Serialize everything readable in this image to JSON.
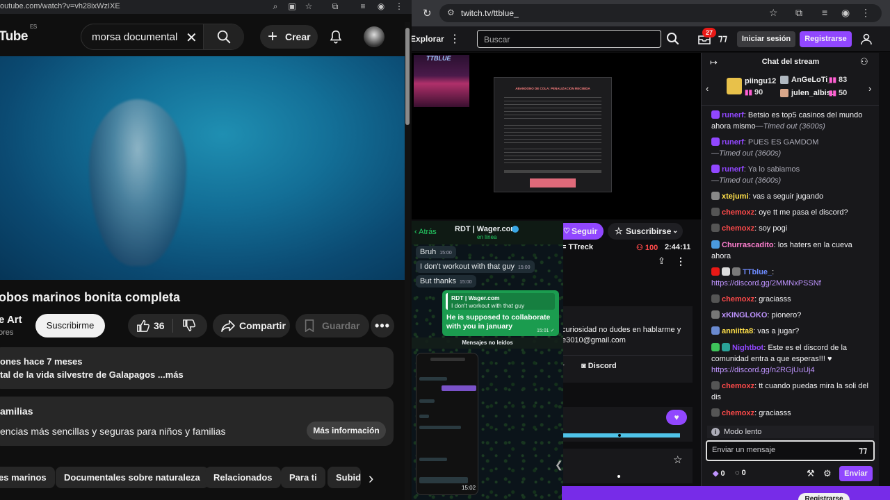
{
  "youtube": {
    "url": "outube.com/watch?v=vh28ixWzIXE",
    "logo": "Tube",
    "logo_region": "ES",
    "search_value": "morsa documental",
    "create_label": "Crear",
    "title": "obos marinos bonita completa",
    "channel": "e Art",
    "subs": "ores",
    "subscribe_label": "Suscribirme",
    "likes": "36",
    "share_label": "Compartir",
    "save_label": "Guardar",
    "desc_meta": "ones  hace 7 meses",
    "desc_text": "tal de la vida silvestre de Galapagos ...más",
    "family_title": "amilias",
    "family_text": "encias más sencillas y seguras para niños y familias",
    "family_button": "Más información",
    "chips": [
      "es marinos",
      "Documentales sobre naturaleza",
      "Relacionados",
      "Para ti",
      "Subid"
    ]
  },
  "twitch": {
    "url": "twitch.tv/ttblue_",
    "explore": "Explorar",
    "search_placeholder": "Buscar",
    "notif_count": "27",
    "login_label": "Iniciar sesión",
    "register_label": "Registrarse",
    "cam_label": "TTBLUE",
    "notice_title": "ABANDONO DE COLA: PENALIZACION RECIBIDA",
    "follow_label": "Seguir",
    "subscribe_label": "Suscribirse",
    "streamer_name": "= TTreck",
    "viewers": "100",
    "uptime": "2:44:11",
    "about_text": "curiosidad no dudes en hablarme y",
    "about_email": "e3010@gmail.com",
    "about_r": "r",
    "discord_label": "Discord",
    "chat_title": "Chat del stream",
    "gifters": [
      {
        "name": "piingu12",
        "count": "90"
      },
      {
        "name": "AnGeLoTi_",
        "count": "83"
      },
      {
        "name": "julen_albisu",
        "count": "50"
      }
    ],
    "messages": [
      {
        "user": "runerf",
        "color": "#9147ff",
        "text": ": Betsio es top5 casinos del mundo ahora mismo",
        "note": "—Timed out (3600s)"
      },
      {
        "user": "runerf",
        "color": "#9147ff",
        "text": ": PUES ES GAMDOM",
        "note": "—Timed out (3600s)"
      },
      {
        "user": "runerf",
        "color": "#9147ff",
        "text": ": Ya lo sabiamos",
        "note": "—Timed out (3600s)"
      },
      {
        "user": "xtejumi",
        "color": "#ffe04a",
        "text": ": vas a seguir jugando",
        "note": ""
      },
      {
        "user": "chemoxz",
        "color": "#ff4a4a",
        "text": ": oye tt me pasa el discord?",
        "note": ""
      },
      {
        "user": "chemoxz",
        "color": "#ff4a4a",
        "text": ": soy pogi",
        "note": ""
      },
      {
        "user": "Churrascadito",
        "color": "#ff7fd0",
        "text": ": los haters en la cueva ahora",
        "note": ""
      },
      {
        "user": "TTblue_",
        "color": "#6e8bff",
        "text": ":",
        "link": "https://discord.gg/2MMNxPSSNf"
      },
      {
        "user": "chemoxz",
        "color": "#ff4a4a",
        "text": ": graciasss",
        "note": ""
      },
      {
        "user": "xKINGLOKO",
        "color": "#bf94ff",
        "text": ": pionero?",
        "note": ""
      },
      {
        "user": "anniitta8",
        "color": "#ffe04a",
        "text": ": vas a jugar?",
        "note": ""
      },
      {
        "user": "Nightbot",
        "color": "#9147ff",
        "text": ": Este es el discord de la comunidad entra a que esperas!!! ♥",
        "link": "https://discord.gg/n2RGjUuUj4"
      },
      {
        "user": "chemoxz",
        "color": "#ff4a4a",
        "text": ": tt cuando puedas mira la soli del dis",
        "note": ""
      },
      {
        "user": "chemoxz",
        "color": "#ff4a4a",
        "text": ": graciasss",
        "note": ""
      }
    ],
    "slow_mode": "Modo lento",
    "chat_placeholder": "Enviar un mensaje",
    "points": "0",
    "points2": "0",
    "send_label": "Enviar",
    "bottom_button": "Registrarse"
  },
  "whatsapp": {
    "back": "Atrás",
    "name": "RDT | Wager.com",
    "status": "en línea",
    "messages_in": [
      {
        "text": "Bruh",
        "time": "15:00"
      },
      {
        "text": "I don't workout with that guy",
        "time": "15:00"
      },
      {
        "text": "But thanks",
        "time": "15:00"
      }
    ],
    "reply_quote_name": "RDT | Wager.com",
    "reply_quote_text": "I don't workout with that guy",
    "reply_text": "He is supposed to collaborate with you in january",
    "reply_time": "15:01",
    "unread_label": "Mensajes no leídos",
    "shot_time": "15:02"
  },
  "colors": {
    "twitch_purple": "#9147ff",
    "youtube_bg": "#0f0f0f",
    "whatsapp_green": "#1b9c4f"
  }
}
